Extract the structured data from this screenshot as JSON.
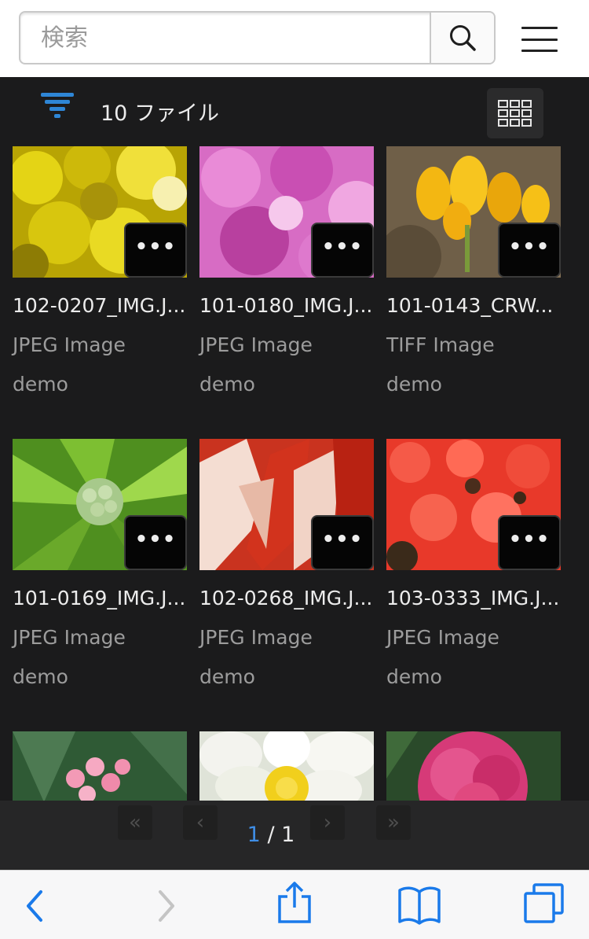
{
  "search": {
    "placeholder": "検索"
  },
  "toolbar": {
    "file_count": "10 ファイル"
  },
  "files": [
    {
      "name": "102-0207_IMG.J...",
      "type": "JPEG Image",
      "owner": "demo"
    },
    {
      "name": "101-0180_IMG.J...",
      "type": "JPEG Image",
      "owner": "demo"
    },
    {
      "name": "101-0143_CRW...",
      "type": "TIFF Image",
      "owner": "demo"
    },
    {
      "name": "101-0169_IMG.J...",
      "type": "JPEG Image",
      "owner": "demo"
    },
    {
      "name": "102-0268_IMG.J...",
      "type": "JPEG Image",
      "owner": "demo"
    },
    {
      "name": "103-0333_IMG.J...",
      "type": "JPEG Image",
      "owner": "demo"
    },
    {
      "name": "",
      "type": "",
      "owner": ""
    },
    {
      "name": "",
      "type": "",
      "owner": ""
    },
    {
      "name": "",
      "type": "",
      "owner": ""
    }
  ],
  "more_label": "•••",
  "pagination": {
    "current": "1",
    "separator": " / ",
    "total": "1",
    "first": "«",
    "prev": "‹",
    "next": "›",
    "last": "»"
  },
  "icons": {
    "search": "search-icon",
    "menu": "hamburger-menu-icon",
    "filter": "filter-icon",
    "grid_view": "grid-view-icon",
    "back": "back-chevron-icon",
    "forward": "forward-chevron-icon",
    "share": "share-icon",
    "bookmarks": "bookmarks-icon",
    "tabs": "tabs-icon"
  },
  "colors": {
    "accent": "#3f8ee6",
    "background": "#1b1b1c",
    "filter_icon": "#2e86d6",
    "browser_tint": "#1a7aea"
  }
}
